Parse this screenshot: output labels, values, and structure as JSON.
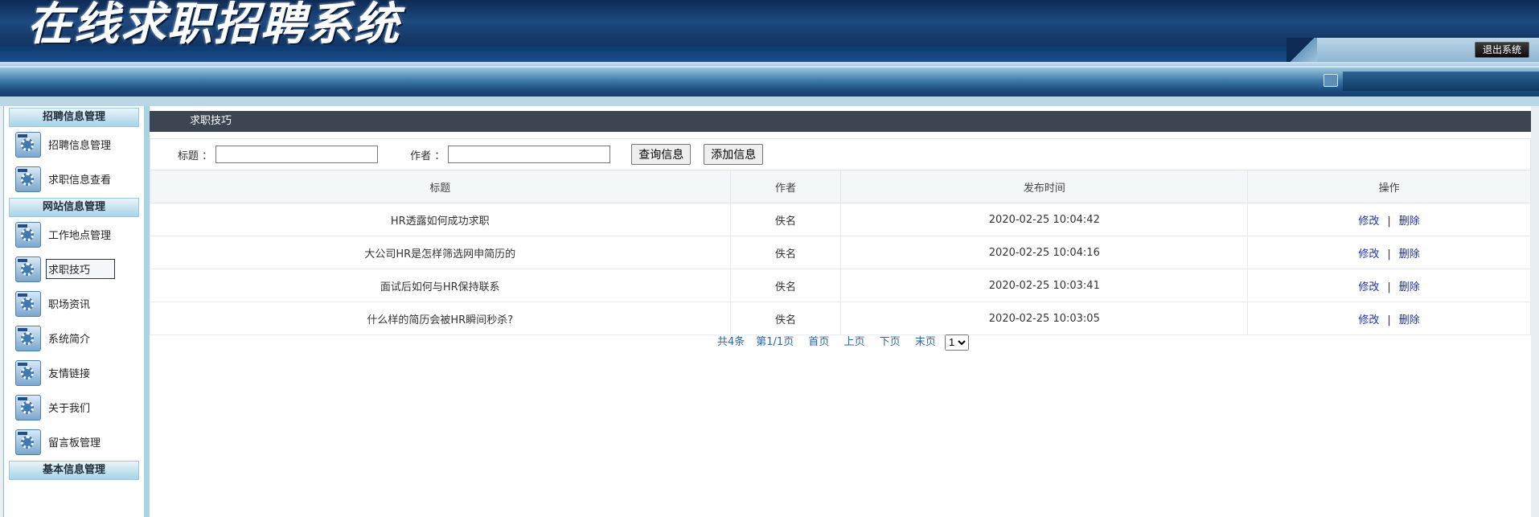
{
  "header": {
    "title": "在线求职招聘系统",
    "logout_label": "退出系统"
  },
  "sidebar": {
    "groups": [
      {
        "title": "招聘信息管理",
        "items": [
          "招聘信息管理",
          "求职信息查看"
        ]
      },
      {
        "title": "网站信息管理",
        "items": [
          "工作地点管理",
          "求职技巧",
          "职场资讯",
          "系统简介",
          "友情链接",
          "关于我们",
          "留言板管理"
        ]
      },
      {
        "title": "基本信息管理",
        "items": []
      }
    ],
    "active_item": "求职技巧"
  },
  "main": {
    "tab_title": "求职技巧",
    "search": {
      "title_label": "标题 ：",
      "title_value": "",
      "author_label": "作者 ：",
      "author_value": "",
      "query_button": "查询信息",
      "add_button": "添加信息"
    },
    "table": {
      "columns": [
        "标题",
        "作者",
        "发布时间",
        "操作"
      ],
      "rows": [
        {
          "title": "HR透露如何成功求职",
          "author": "佚名",
          "time": "2020-02-25 10:04:42"
        },
        {
          "title": "大公司HR是怎样筛选网申简历的",
          "author": "佚名",
          "time": "2020-02-25 10:04:16"
        },
        {
          "title": "面试后如何与HR保持联系",
          "author": "佚名",
          "time": "2020-02-25 10:03:41"
        },
        {
          "title": "什么样的简历会被HR瞬间秒杀?",
          "author": "佚名",
          "time": "2020-02-25 10:03:05"
        }
      ],
      "edit_label": "修改",
      "separator": "|",
      "delete_label": "删除"
    },
    "pager": {
      "total": "共4条",
      "page": "第1/1页",
      "first": "首页",
      "prev": "上页",
      "next": "下页",
      "last": "末页",
      "selected_page": "1"
    }
  }
}
